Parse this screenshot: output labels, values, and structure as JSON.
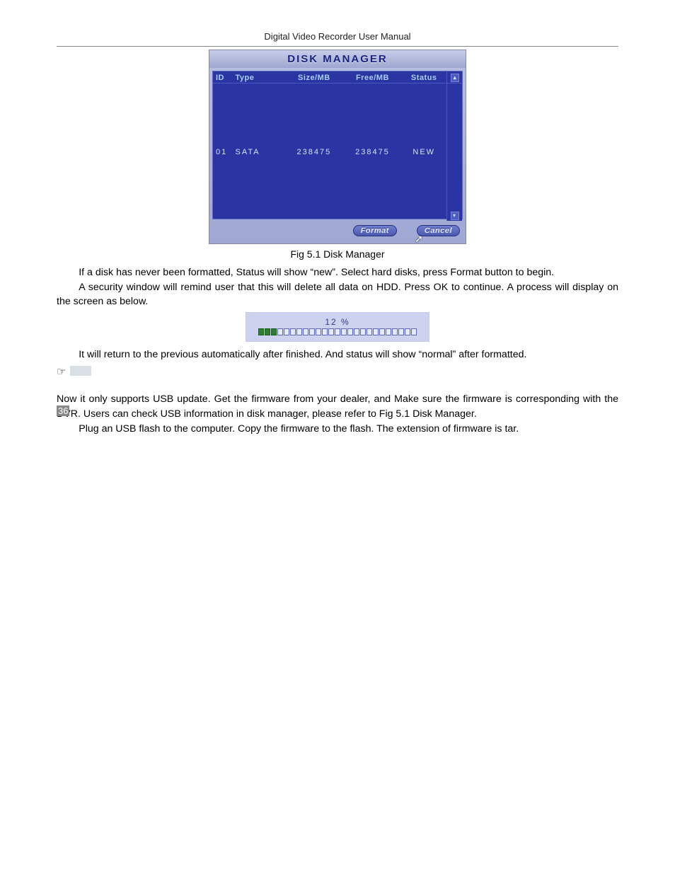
{
  "header": "Digital Video Recorder User Manual",
  "dm": {
    "title": "DISK MANAGER",
    "columns": {
      "id": "ID",
      "type": "Type",
      "size": "Size/MB",
      "free": "Free/MB",
      "status": "Status"
    },
    "rows": [
      {
        "id": "01",
        "type": "SATA",
        "size": "238475",
        "free": "238475",
        "status": "NEW"
      }
    ],
    "format_btn": "Format",
    "cancel_btn": "Cancel"
  },
  "figcaption": "Fig 5.1 Disk Manager",
  "para1": "If a disk has never been formatted, Status will show “new”. Select hard disks, press Format button to begin.",
  "para2": "A security window will remind user that this will delete all data on HDD. Press OK to continue. A process will display on the screen as below.",
  "progress": {
    "label": "12 %",
    "filled": 3,
    "total": 25
  },
  "para3": "It will return to the previous automatically after finished. And status will show “normal” after formatted.",
  "para4": "Now it only supports USB update. Get the firmware from your dealer, and Make sure the firmware is corresponding with the DVR. Users can check USB information in disk manager, please refer to Fig 5.1 Disk Manager.",
  "para5": "Plug an USB flash to the computer. Copy the firmware to the flash. The extension of firmware is tar.",
  "page_number": "36"
}
